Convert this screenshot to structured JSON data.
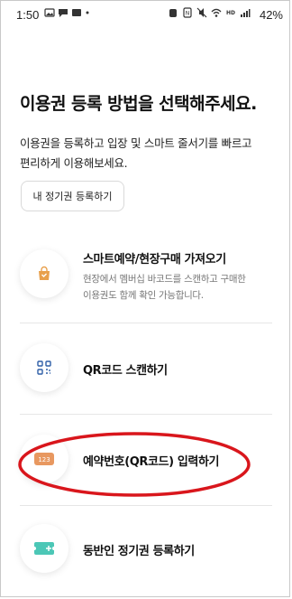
{
  "status_bar": {
    "time": "1:50",
    "battery": "42%"
  },
  "main": {
    "title": "이용권 등록 방법을 선택해주세요.",
    "subtitle_line1": "이용권을 등록하고 입장 및 스마트 줄서기를 빠르고",
    "subtitle_line2": "편리하게 이용해보세요.",
    "season_pass_button": "내 정기권 등록하기"
  },
  "options": [
    {
      "label": "스마트예약/현장구매 가져오기",
      "desc_line1": "현장에서 멤버십 바코드를 스캔하고 구매한",
      "desc_line2": "이용권도 함께 확인 가능합니다.",
      "icon": "shopping-bag-icon"
    },
    {
      "label": "QR코드 스캔하기",
      "icon": "qr-scan-icon"
    },
    {
      "label": "예약번호(QR코드) 입력하기",
      "icon": "number-123-icon",
      "icon_text": "123"
    },
    {
      "label": "동반인 정기권 등록하기",
      "icon": "ticket-add-icon"
    }
  ],
  "colors": {
    "bag": "#E8A04C",
    "qr": "#2F5FA7",
    "badge": "#E89860",
    "ticket": "#4CC7B6",
    "annotation": "#D9161C"
  }
}
